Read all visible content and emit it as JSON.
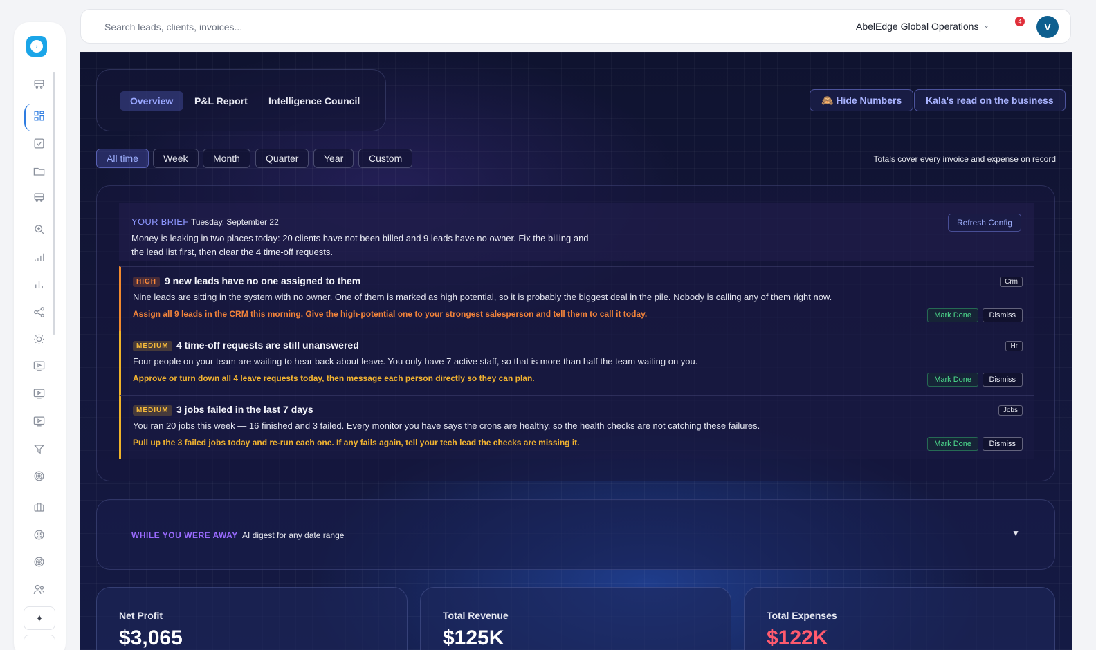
{
  "sidebar": {
    "logo_glyph": "›",
    "icons": [
      "bus-icon",
      "dashboard-icon",
      "checkbox-icon",
      "folder-icon",
      "bus-icon",
      "search-zoom-icon",
      "signal-icon",
      "bar-chart-icon",
      "share-icon",
      "sun-icon",
      "monitor-play-icon",
      "monitor-play-icon",
      "monitor-play-icon",
      "filter-icon",
      "target-icon",
      "briefcase-icon",
      "brain-icon",
      "target-icon",
      "users-icon"
    ],
    "sparkle_glyph": "✦"
  },
  "topbar": {
    "search_placeholder": "Search leads, clients, invoices...",
    "org_name": "AbelEdge Global Operations",
    "notification_count": "4",
    "avatar_initial": "V"
  },
  "view_tabs": [
    {
      "label": "Overview",
      "active": true
    },
    {
      "label": "P&L Report",
      "active": false
    },
    {
      "label": "Intelligence Council",
      "active": false
    }
  ],
  "actions": {
    "hide_numbers": "🙈 Hide Numbers",
    "kala_read": "Kala's read on the business"
  },
  "ranges": [
    {
      "label": "All time",
      "active": true
    },
    {
      "label": "Week",
      "active": false
    },
    {
      "label": "Month",
      "active": false
    },
    {
      "label": "Quarter",
      "active": false
    },
    {
      "label": "Year",
      "active": false
    },
    {
      "label": "Custom",
      "active": false
    }
  ],
  "range_note": "Totals cover every invoice and expense on record",
  "brief": {
    "label": "YOUR BRIEF",
    "date": "Tuesday, September 22",
    "text": "Money is leaking in two places today: 20 clients have not been billed and 9 leads have no owner. Fix the billing and the lead list first, then clear the 4 time-off requests.",
    "refresh_label": "Refresh Config",
    "items": [
      {
        "priority": "HIGH",
        "title": "9 new leads have no one assigned to them",
        "description": "Nine leads are sitting in the system with no owner. One of them is marked as high potential, so it is probably the biggest deal in the pile. Nobody is calling any of them right now.",
        "action": "Assign all 9 leads in the CRM this morning. Give the high-potential one to your strongest salesperson and tell them to call it today.",
        "tag": "Crm",
        "mark_done": "Mark Done",
        "dismiss": "Dismiss"
      },
      {
        "priority": "MEDIUM",
        "title": "4 time-off requests are still unanswered",
        "description": "Four people on your team are waiting to hear back about leave. You only have 7 active staff, so that is more than half the team waiting on you.",
        "action": "Approve or turn down all 4 leave requests today, then message each person directly so they can plan.",
        "tag": "Hr",
        "mark_done": "Mark Done",
        "dismiss": "Dismiss"
      },
      {
        "priority": "MEDIUM",
        "title": "3 jobs failed in the last 7 days",
        "description": "You ran 20 jobs this week — 16 finished and 3 failed. Every monitor you have says the crons are healthy, so the health checks are not catching these failures.",
        "action": "Pull up the 3 failed jobs today and re-run each one. If any fails again, tell your tech lead the checks are missing it.",
        "tag": "Jobs",
        "mark_done": "Mark Done",
        "dismiss": "Dismiss"
      }
    ]
  },
  "away": {
    "label": "WHILE YOU WERE AWAY",
    "subtitle": "AI digest for any date range",
    "caret": "▼"
  },
  "stats": [
    {
      "label": "Net Profit",
      "value": "$3,065"
    },
    {
      "label": "Total Revenue",
      "value": "$125K"
    },
    {
      "label": "Total Expenses",
      "value": "$122K"
    }
  ]
}
